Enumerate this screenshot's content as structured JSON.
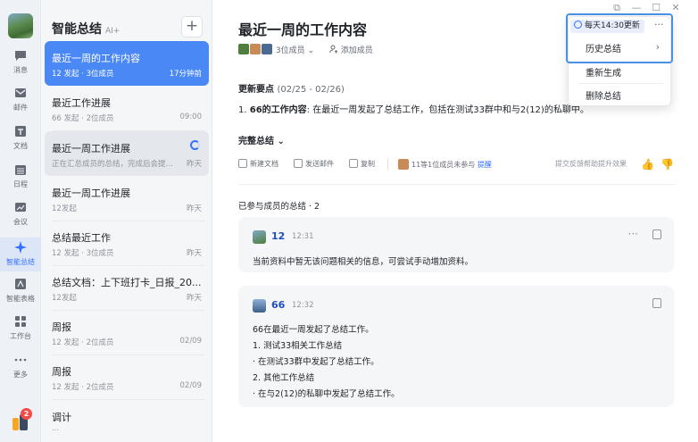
{
  "window": {
    "controls": [
      "⧉",
      "—",
      "☐",
      "✕"
    ]
  },
  "rail": {
    "items": [
      {
        "label": "消息",
        "icon": "chat-bubble-icon"
      },
      {
        "label": "邮件",
        "icon": "mail-icon"
      },
      {
        "label": "文档",
        "icon": "document-icon"
      },
      {
        "label": "日程",
        "icon": "calendar-icon"
      },
      {
        "label": "会议",
        "icon": "video-meeting-icon"
      },
      {
        "label": "智能总结",
        "icon": "sparkle-icon"
      },
      {
        "label": "智能表格",
        "icon": "smart-table-icon"
      },
      {
        "label": "工作台",
        "icon": "grid-apps-icon"
      },
      {
        "label": "更多",
        "icon": "more-dots-icon"
      }
    ],
    "badge": "2"
  },
  "list": {
    "title": "智能总结",
    "ai_tag": "AI+",
    "add_label": "+",
    "items": [
      {
        "title": "最近一周的工作内容",
        "sub": "12 发起 · 3位成员",
        "time": "17分钟前"
      },
      {
        "title": "最近工作进展",
        "sub": "66 发起 · 2位成员",
        "time": "09:00"
      },
      {
        "title": "最近一周工作进展",
        "sub": "正在汇总成员的总结，完成后会提醒...",
        "time": "昨天"
      },
      {
        "title": "最近一周工作进展",
        "sub": "12发起",
        "time": "昨天"
      },
      {
        "title": "总结最近工作",
        "sub": "12 发起 · 3位成员",
        "time": "昨天"
      },
      {
        "title": "总结文档：上下班打卡_日报_20...",
        "sub": "12发起",
        "time": "昨天"
      },
      {
        "title": "周报",
        "sub": "12 发起 · 2位成员",
        "time": "02/09"
      },
      {
        "title": "周报",
        "sub": "12 发起 · 2位成员",
        "time": "02/09"
      },
      {
        "title": "调计",
        "sub": "...",
        "time": ""
      }
    ]
  },
  "main": {
    "title": "最近一周的工作内容",
    "members_label": "3位成员",
    "members_chevron": "⌄",
    "add_member": "添加成员",
    "update_heading": "更新要点",
    "update_range": "(02/25 - 02/26)",
    "summary_prefix": "1. ",
    "summary_bold": "66的工作内容",
    "summary_text": ": 在最近一周发起了总结工作，包括在测试33群中和与2(12)的私聊中。",
    "full_summary": "完整总结",
    "full_summary_chevron": "⌄",
    "toolbar": {
      "new_doc": "新建文档",
      "send_mail": "发送邮件",
      "copy": "复制",
      "not_joined": "11等1位成员未参与",
      "remind": "提醒",
      "feedback": "提交反馈帮助提升效果",
      "like": "👍",
      "dislike": "👎"
    },
    "members_summary_label": "已参与成员的总结 · 2",
    "member_cards": [
      {
        "name": "12",
        "time": "12:31",
        "more": "···",
        "lines": [
          "当前资料中暂无该问题相关的信息，可尝试手动增加资料。"
        ]
      },
      {
        "name": "66",
        "time": "12:32",
        "lines": [
          "66在最近一周发起了总结工作。",
          "1. 测试33相关工作总结",
          "· 在测试33群中发起了总结工作。",
          "2. 其他工作总结",
          "· 在与2(12)的私聊中发起了总结工作。"
        ]
      }
    ]
  },
  "popover": {
    "schedule": "每天14:30更新",
    "ellipsis": "···",
    "history": "历史总结",
    "history_chevron": "›",
    "regenerate": "重新生成",
    "delete": "删除总结"
  },
  "colors": {
    "accent": "#3370ff",
    "active_card": "#4a88f5",
    "highlight": "#4a90e2",
    "badge": "#f54a45"
  }
}
